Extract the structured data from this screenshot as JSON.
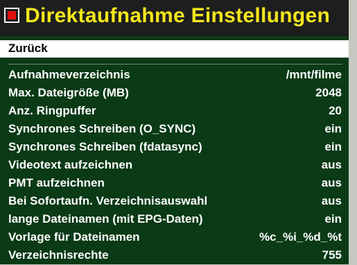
{
  "header": {
    "title": "Direktaufnahme Einstellungen",
    "icon": "record-icon",
    "title_color": "#f4e61c",
    "icon_color": "#e0100f"
  },
  "menu": {
    "back_label": "Zurück",
    "selected_item": "Zurück",
    "items": [
      {
        "label": "Aufnahmeverzeichnis",
        "value": "/mnt/filme"
      },
      {
        "label": "Max. Dateigröße (MB)",
        "value": "2048"
      },
      {
        "label": "Anz. Ringpuffer",
        "value": "20"
      },
      {
        "label": "Synchrones Schreiben (O_SYNC)",
        "value": "ein"
      },
      {
        "label": "Synchrones Schreiben (fdatasync)",
        "value": "ein"
      },
      {
        "label": "Videotext aufzeichnen",
        "value": "aus"
      },
      {
        "label": "PMT aufzeichnen",
        "value": "aus"
      },
      {
        "label": "Bei Sofortaufn. Verzeichnisauswahl",
        "value": "aus"
      },
      {
        "label": "lange Dateinamen (mit EPG-Daten)",
        "value": "ein"
      },
      {
        "label": "Vorlage für Dateinamen",
        "value": "%c_%i_%d_%t"
      },
      {
        "label": "Verzeichnisrechte",
        "value": "755"
      }
    ]
  },
  "colors": {
    "background": "#0a3a16",
    "selection": "#ffffff",
    "text": "#ffffff"
  }
}
